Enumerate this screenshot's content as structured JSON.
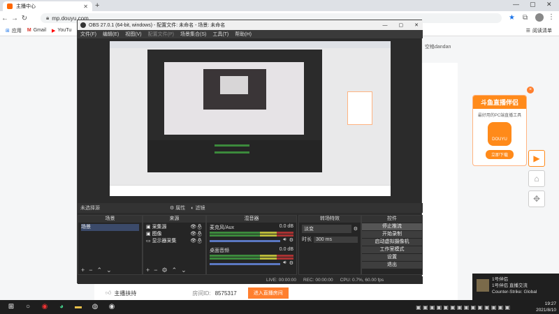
{
  "browser": {
    "tab_title": "主播中心",
    "url": "mp.douyu.com",
    "bookmarks": [
      "应用",
      "Gmail",
      "YouTu"
    ],
    "right_bookmark": "阅读清单",
    "user_label": "空格dandan"
  },
  "obs": {
    "title": "OBS 27.0.1 (64-bit, windows) - 配置文件: 未命名 - 场景: 未命名",
    "menu": [
      "文件(F)",
      "编辑(E)",
      "视图(V)",
      "配置文件(P)",
      "场景集合(S)",
      "工具(T)",
      "帮助(H)"
    ],
    "source_bar": {
      "label": "未选择源",
      "properties": "属性",
      "filters": "滤镜"
    },
    "docks": {
      "scenes": {
        "title": "场景",
        "items": [
          "场景"
        ]
      },
      "sources": {
        "title": "来源",
        "items": [
          "采集源",
          "图像",
          "显示器采集"
        ]
      },
      "mixer": {
        "title": "混音器",
        "channels": [
          {
            "name": "麦克风/Aux",
            "db": "0.0 dB"
          },
          {
            "name": "桌面音频",
            "db": "0.0 dB"
          }
        ]
      },
      "transitions": {
        "title": "转场特效",
        "type": "淡变",
        "duration_label": "时长",
        "duration": "300 ms"
      },
      "controls": {
        "title": "控件",
        "buttons": [
          "停止推流",
          "开始录制",
          "启动虚拟摄像机",
          "工作室模式",
          "设置",
          "退出"
        ]
      }
    },
    "status": {
      "live": "LIVE: 00:00:00",
      "rec": "REC: 00:00:00",
      "cpu": "CPU: 0.7%, 60.00 fps"
    }
  },
  "page": {
    "room_label": "房间ID:",
    "room_id": "8575317",
    "enter_button": "进入直播房间",
    "support_label": "主播扶持"
  },
  "ad": {
    "title": "斗鱼直播伴侣",
    "subtitle": "最好用的PC端直播工具",
    "brand": "DOUYU",
    "button": "立即下载"
  },
  "notification": {
    "app": "1号伴侣",
    "line1": "1号伴侣 直播交流",
    "line2": "Counter-Strike: Global"
  },
  "clock": {
    "time": "19:27",
    "date": "2021/8/10"
  }
}
